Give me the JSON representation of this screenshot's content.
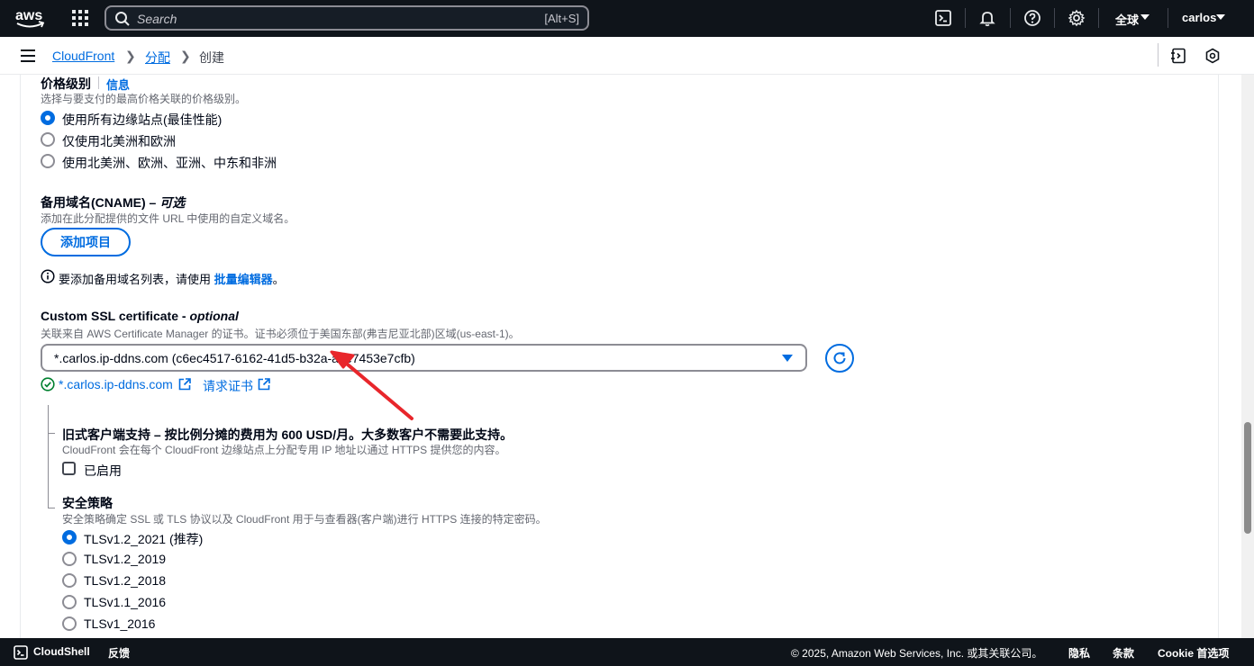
{
  "topnav": {
    "logo": "aws",
    "search_placeholder": "Search",
    "search_shortcut": "[Alt+S]",
    "region": "全球",
    "account": "carlos"
  },
  "breadcrumb": {
    "items": [
      "CloudFront",
      "分配",
      "创建"
    ]
  },
  "price_class": {
    "label": "价格级别",
    "info": "信息",
    "description": "选择与要支付的最高价格关联的价格级别。",
    "options": [
      {
        "label": "使用所有边缘站点(最佳性能)",
        "checked": true
      },
      {
        "label": "仅使用北美洲和欧洲",
        "checked": false
      },
      {
        "label": "使用北美洲、欧洲、亚洲、中东和非洲",
        "checked": false
      }
    ]
  },
  "cname": {
    "label": "备用域名(CNAME) – ",
    "optional": "可选",
    "description": "添加在此分配提供的文件 URL 中使用的自定义域名。",
    "add_button": "添加项目",
    "hint_prefix": "要添加备用域名列表，请使用 ",
    "hint_link": "批量编辑器",
    "hint_suffix": "。"
  },
  "ssl": {
    "label": "Custom SSL certificate - ",
    "optional": "optional",
    "description": "关联来自 AWS Certificate Manager 的证书。证书必须位于美国东部(弗吉尼亚北部)区域(us-east-1)。",
    "selected": "*.carlos.ip-ddns.com (c6ec4517-6162-41d5-b32a-ace7453e7cfb)",
    "status_link": "*.carlos.ip-ddns.com",
    "request_link": "请求证书"
  },
  "legacy": {
    "label": "旧式客户端支持 – 按比例分摊的费用为 600 USD/月。大多数客户不需要此支持。",
    "description": "CloudFront 会在每个 CloudFront 边缘站点上分配专用 IP 地址以通过 HTTPS 提供您的内容。",
    "checkbox_label": "已启用"
  },
  "security_policy": {
    "label": "安全策略",
    "description": "安全策略确定 SSL 或 TLS 协议以及 CloudFront 用于与查看器(客户端)进行 HTTPS 连接的特定密码。",
    "options": [
      {
        "label": "TLSv1.2_2021 (推荐)",
        "checked": true
      },
      {
        "label": "TLSv1.2_2019",
        "checked": false
      },
      {
        "label": "TLSv1.2_2018",
        "checked": false
      },
      {
        "label": "TLSv1.1_2016",
        "checked": false
      },
      {
        "label": "TLSv1_2016",
        "checked": false
      }
    ]
  },
  "footer": {
    "cloudshell": "CloudShell",
    "feedback": "反馈",
    "copyright": "© 2025, Amazon Web Services, Inc. 或其关联公司。",
    "privacy": "隐私",
    "terms": "条款",
    "cookie": "Cookie 首选项"
  },
  "colors": {
    "nav_bg": "#0f141a",
    "link": "#006ce0",
    "success": "#00802f",
    "arrow": "#e8262b"
  }
}
